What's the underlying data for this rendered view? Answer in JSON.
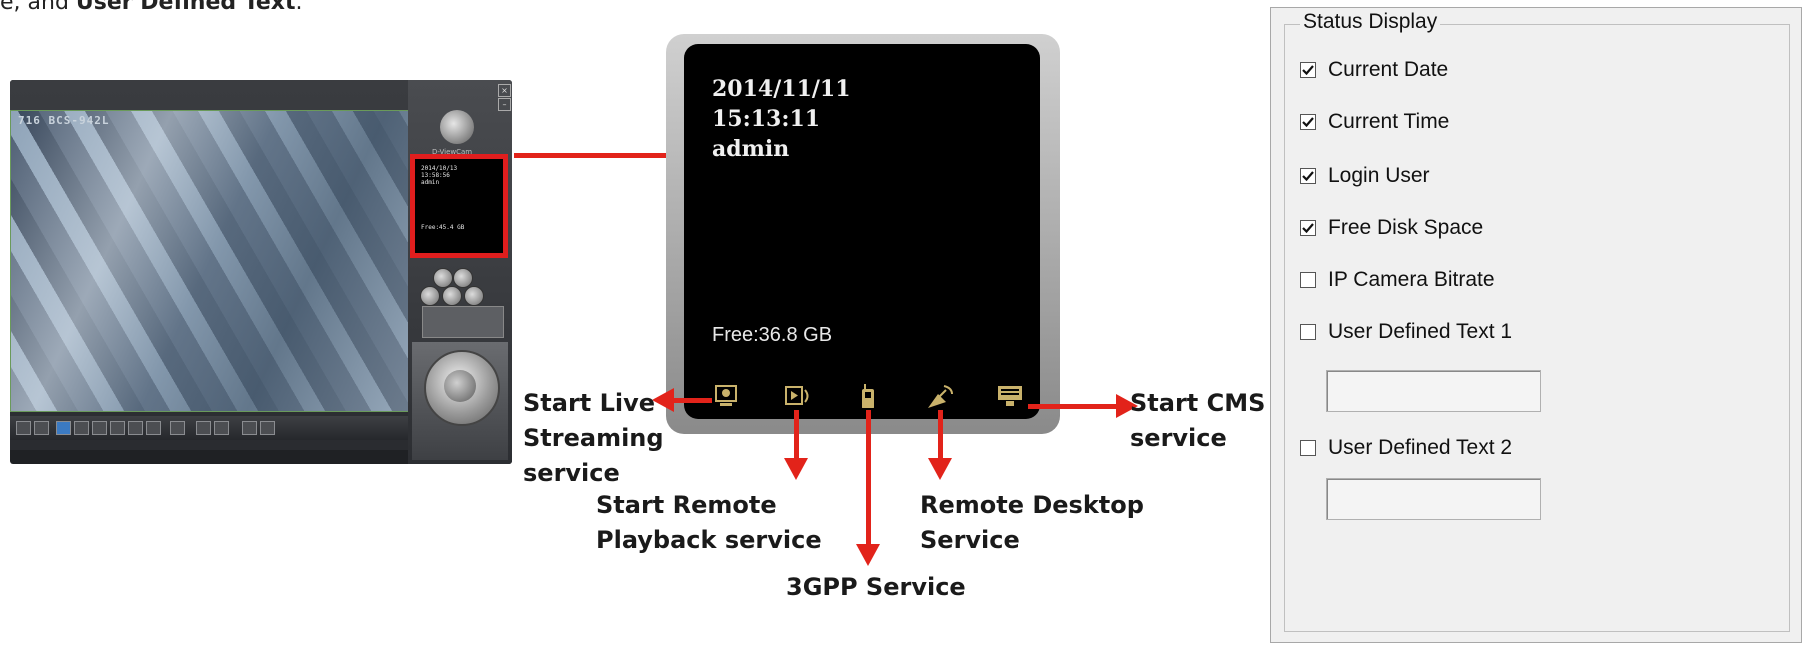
{
  "intro": {
    "part1": "e, and ",
    "bold": "User Defined Text",
    "part2": "."
  },
  "app": {
    "video_caption": "716 BCS-942L",
    "mini_status": [
      "2014/10/13",
      "13:58:56",
      "admin",
      "",
      "",
      "",
      "Free:45.4 GB"
    ],
    "logo_text": "D-ViewCam"
  },
  "status_panel": {
    "date": "2014/11/11",
    "time": "15:13:11",
    "user": "admin",
    "free": "Free:36.8 GB"
  },
  "labels": {
    "live_streaming": [
      "Start Live",
      "Streaming",
      "service"
    ],
    "remote_playback": [
      "Start Remote",
      "Playback service"
    ],
    "gpp": "3GPP Service",
    "remote_desktop": [
      "Remote Desktop",
      "Service"
    ],
    "cms": [
      "Start CMS",
      "service"
    ]
  },
  "status_display": {
    "title": "Status Display",
    "items": [
      {
        "label": "Current Date",
        "checked": true
      },
      {
        "label": "Current Time",
        "checked": true
      },
      {
        "label": "Login User",
        "checked": true
      },
      {
        "label": "Free Disk Space",
        "checked": true
      },
      {
        "label": "IP Camera Bitrate",
        "checked": false
      },
      {
        "label": "User Defined Text 1",
        "checked": false
      },
      {
        "label": "User Defined Text 2",
        "checked": false
      }
    ],
    "user_text_1": "",
    "user_text_2": ""
  },
  "colors": {
    "arrow": "#e2231a",
    "highlight": "#e01e1e"
  }
}
